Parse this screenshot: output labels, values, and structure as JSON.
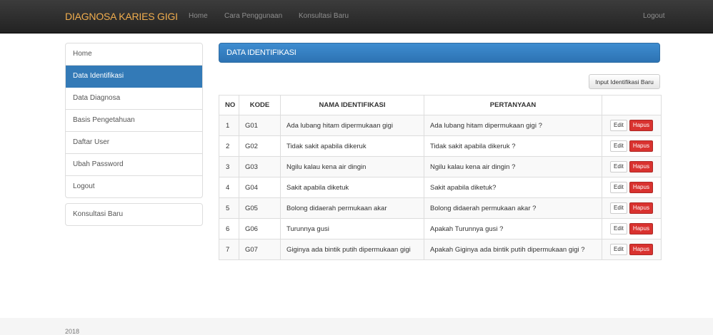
{
  "navbar": {
    "brand": "DIAGNOSA KARIES GIGI",
    "links": [
      "Home",
      "Cara Penggunaan",
      "Konsultasi Baru"
    ],
    "logout": "Logout"
  },
  "sidebar": {
    "items": [
      "Home",
      "Data Identifikasi",
      "Data Diagnosa",
      "Basis Pengetahuan",
      "Daftar User",
      "Ubah Password",
      "Logout"
    ],
    "active": "Data Identifikasi",
    "extra": "Konsultasi Baru"
  },
  "panel": {
    "title": "DATA IDENTIFIKASI"
  },
  "toolbar": {
    "new_label": "Input Identifikasi Baru"
  },
  "table": {
    "headers": [
      "NO",
      "KODE",
      "NAMA IDENTIFIKASI",
      "PERTANYAAN",
      ""
    ],
    "rows": [
      [
        "1",
        "G01",
        "Ada lubang hitam dipermukaan gigi",
        "Ada lubang hitam dipermukaan gigi ?"
      ],
      [
        "2",
        "G02",
        "Tidak sakit apabila dikeruk",
        "Tidak sakit apabila dikeruk ?"
      ],
      [
        "3",
        "G03",
        "Ngilu kalau kena air dingin",
        "Ngilu kalau kena air dingin ?"
      ],
      [
        "4",
        "G04",
        "Sakit apabila diketuk",
        "Sakit apabila diketuk?"
      ],
      [
        "5",
        "G05",
        "Bolong didaerah permukaan akar",
        "Bolong didaerah permukaan akar ?"
      ],
      [
        "6",
        "G06",
        "Turunnya gusi",
        "Apakah Turunnya gusi ?"
      ],
      [
        "7",
        "G07",
        "Giginya ada bintik putih dipermukaan gigi",
        "Apakah Giginya ada bintik putih dipermukaan gigi ?"
      ]
    ],
    "edit_label": "Edit",
    "delete_label": "Hapus"
  },
  "footer": {
    "text": "2018"
  },
  "colors": {
    "brand": "#f0ad4e",
    "primary": "#337ab7",
    "danger": "#d9322f",
    "navbar": "#222222"
  }
}
